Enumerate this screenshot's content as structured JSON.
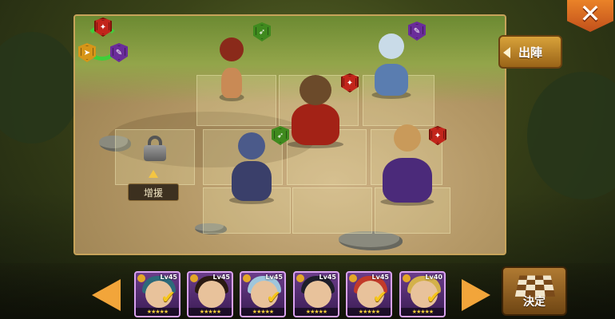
{
  "header": {
    "deploy_label": "出陣",
    "close_label": "✕"
  },
  "field": {
    "reinforce_label": "增援",
    "lock_icon": "lock-icon"
  },
  "roster": [
    {
      "level": "Lv45",
      "stars": "★★★★★",
      "selected": true,
      "hair": "#2d6a7a"
    },
    {
      "level": "Lv45",
      "stars": "★★★★★",
      "selected": false,
      "hair": "#2a1a12"
    },
    {
      "level": "Lv45",
      "stars": "★★★★★",
      "selected": true,
      "hair": "#9fc6dc"
    },
    {
      "level": "Lv45",
      "stars": "★★★★★",
      "selected": false,
      "hair": "#1e1e2a"
    },
    {
      "level": "Lv45",
      "stars": "★★★★★",
      "selected": true,
      "hair": "#c23a2a"
    },
    {
      "level": "Lv40",
      "stars": "★★★★★",
      "selected": true,
      "hair": "#d4b14a"
    }
  ],
  "footer": {
    "confirm_label": "決定"
  },
  "colors": {
    "accent": "#f2a53a",
    "field_border": "#c7a35a",
    "badge_red": "#c2251b",
    "badge_green": "#3f8a1e",
    "badge_purple": "#6a2c9a"
  }
}
